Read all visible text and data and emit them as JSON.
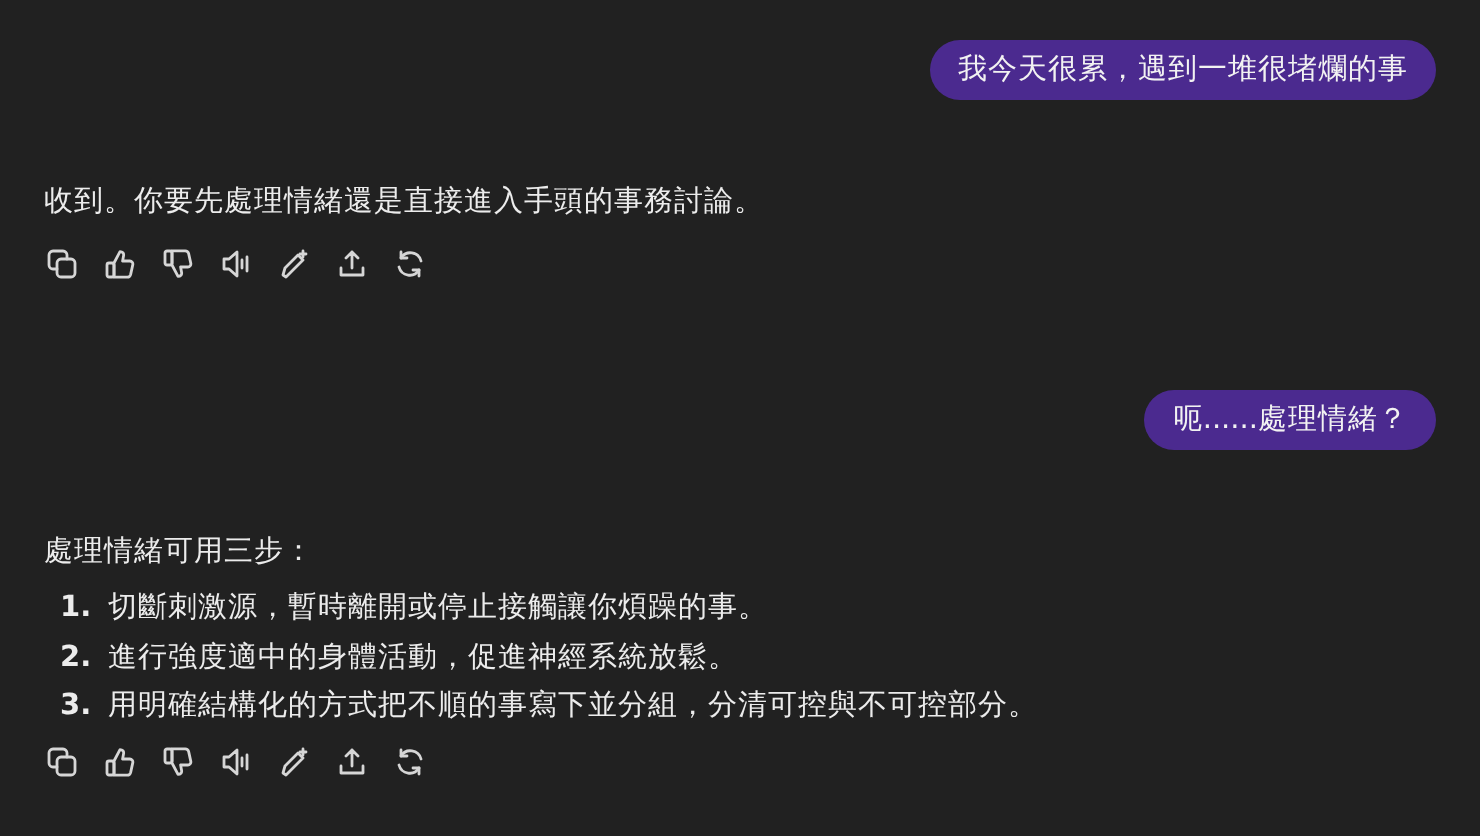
{
  "messages": [
    {
      "kind": "user",
      "text": "我今天很累，遇到一堆很堵爛的事"
    },
    {
      "kind": "assistant",
      "text": "收到。你要先處理情緒還是直接進入手頭的事務討論。"
    },
    {
      "kind": "user",
      "text": "呃......處理情緒？"
    },
    {
      "kind": "assistant",
      "text": "處理情緒可用三步：",
      "list": [
        {
          "number": "1.",
          "text": "切斷刺激源，暫時離開或停止接觸讓你煩躁的事。"
        },
        {
          "number": "2.",
          "text": "進行強度適中的身體活動，促進神經系統放鬆。"
        },
        {
          "number": "3.",
          "text": "用明確結構化的方式把不順的事寫下並分組，分清可控與不可控部分。"
        }
      ]
    }
  ]
}
